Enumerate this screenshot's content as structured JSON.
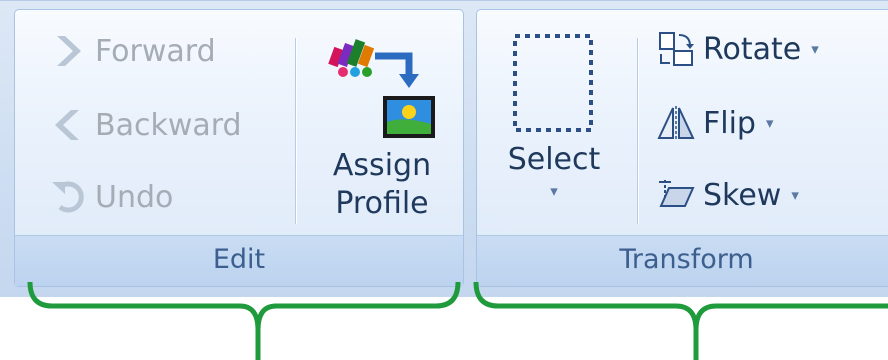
{
  "edit_group": {
    "label": "Edit",
    "forward_label": "Forward",
    "backward_label": "Backward",
    "undo_label": "Undo",
    "assign_profile_label_line1": "Assign",
    "assign_profile_label_line2": "Profile"
  },
  "transform_group": {
    "label": "Transform",
    "select_label": "Select",
    "select_caret": "▾",
    "rotate_label": "Rotate",
    "flip_label": "Flip",
    "skew_label": "Skew",
    "dropdown_caret": "▾"
  },
  "colors": {
    "text": "#1e395b",
    "disabled": "#a6acb4",
    "bracket": "#1f9a3c"
  }
}
